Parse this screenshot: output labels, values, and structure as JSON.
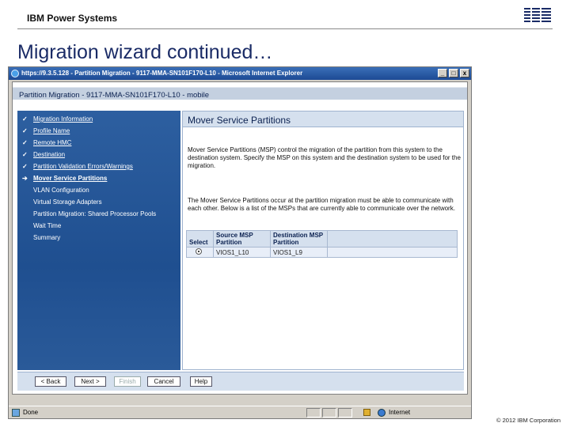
{
  "slide": {
    "header": "IBM Power Systems",
    "logo_text": "IBM",
    "title": "Migration wizard continued…",
    "footer": "© 2012 IBM Corporation"
  },
  "browser": {
    "title": "https://9.3.5.128 - Partition Migration - 9117-MMA-SN101F170-L10 - Microsoft Internet Explorer",
    "controls": [
      "_",
      "□",
      "x"
    ],
    "status": "Done",
    "zone": "Internet"
  },
  "app": {
    "header": "Partition Migration - 9117-MMA-SN101F170-L10 - mobile"
  },
  "nav": {
    "items": [
      {
        "label": "Migration Information",
        "state": "done"
      },
      {
        "label": "Profile Name",
        "state": "done"
      },
      {
        "label": "Remote HMC",
        "state": "done"
      },
      {
        "label": "Destination",
        "state": "done"
      },
      {
        "label": "Partition Validation Errors/Warnings",
        "state": "done"
      },
      {
        "label": "Mover Service Partitions",
        "state": "current"
      },
      {
        "label": "VLAN Configuration",
        "state": "pending"
      },
      {
        "label": "Virtual Storage Adapters",
        "state": "pending"
      },
      {
        "label": "Partition Migration: Shared Processor Pools",
        "state": "pending"
      },
      {
        "label": "Wait Time",
        "state": "pending"
      },
      {
        "label": "Summary",
        "state": "pending"
      }
    ],
    "check_mark": "✓",
    "current_mark": "➔"
  },
  "content": {
    "title": "Mover Service Partitions",
    "para1": "Mover Service Partitions (MSP) control the migration of the partition from this system to the destination system. Specify the MSP on this system and the destination system to be used for the migration.",
    "para2": "The Mover Service Partitions occur at the partition migration must be able to communicate with each other. Below is a list of the MSPs that are currently able to communicate over the network.",
    "table": {
      "headers": {
        "select": "Select",
        "source": "Source MSP Partition",
        "destination": "Destination MSP Partition"
      },
      "rows": [
        {
          "selected": true,
          "source": "VIOS1_L10",
          "destination": "VIOS1_L9"
        }
      ]
    }
  },
  "buttons": {
    "back": "< Back",
    "next": "Next >",
    "finish": "Finish",
    "cancel": "Cancel",
    "help": "Help"
  }
}
